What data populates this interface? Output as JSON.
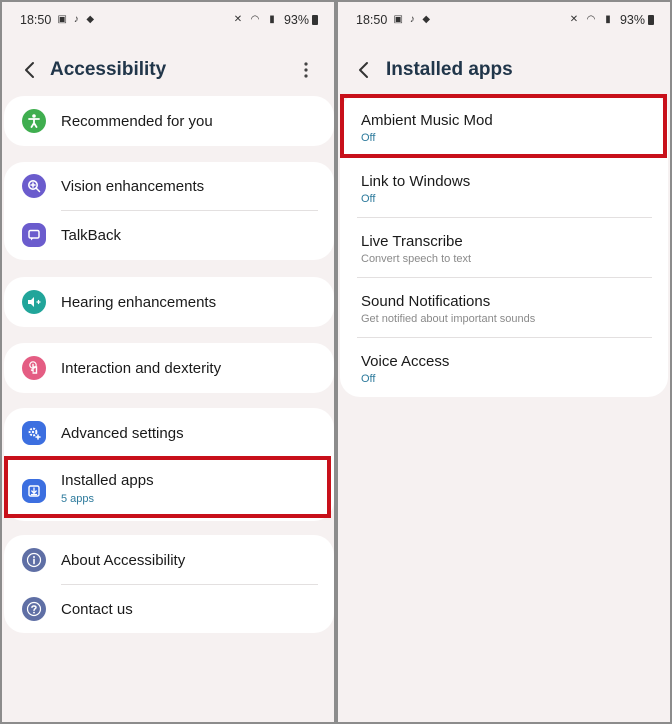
{
  "status": {
    "time": "18:50",
    "battery": "93%"
  },
  "left": {
    "title": "Accessibility",
    "items": [
      {
        "label": "Recommended for you"
      },
      {
        "label": "Vision enhancements"
      },
      {
        "label": "TalkBack"
      },
      {
        "label": "Hearing enhancements"
      },
      {
        "label": "Interaction and dexterity"
      },
      {
        "label": "Advanced settings"
      },
      {
        "label": "Installed apps",
        "sub": "5 apps"
      },
      {
        "label": "About Accessibility"
      },
      {
        "label": "Contact us"
      }
    ]
  },
  "right": {
    "title": "Installed apps",
    "apps": [
      {
        "label": "Ambient Music Mod",
        "sub": "Off"
      },
      {
        "label": "Link to Windows",
        "sub": "Off"
      },
      {
        "label": "Live Transcribe",
        "sub": "Convert speech to text"
      },
      {
        "label": "Sound Notifications",
        "sub": "Get notified about important sounds"
      },
      {
        "label": "Voice Access",
        "sub": "Off"
      }
    ]
  },
  "colors": {
    "green": "#3fae4f",
    "purple": "#6b5ccd",
    "teal": "#21a59a",
    "pink": "#e45d83",
    "blue": "#3c6fe0",
    "slate": "#5f6fa5",
    "highlight": "#c8101a",
    "accent_text": "#2d7a9c"
  }
}
